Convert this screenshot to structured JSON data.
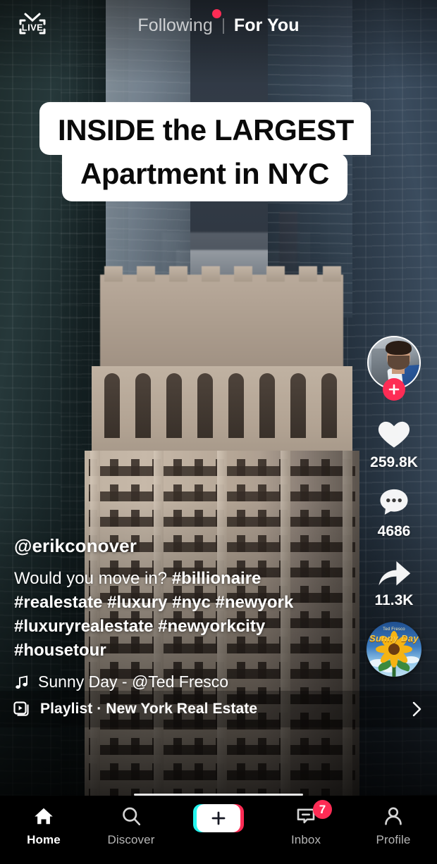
{
  "top_nav": {
    "live_label": "LIVE",
    "live_icon": "live-tv-icon",
    "tabs": [
      {
        "label": "Following",
        "active": false,
        "has_dot_badge": true
      },
      {
        "label": "For You",
        "active": true,
        "has_dot_badge": false
      }
    ]
  },
  "video": {
    "sticker_lines": [
      "INSIDE the LARGEST",
      "Apartment in NYC"
    ],
    "sticker_bg": "#ffffff",
    "sticker_text_color": "#0a0a0a"
  },
  "actions": {
    "avatar_alt": "erikconover-avatar",
    "follow_label": "+",
    "like": {
      "icon": "heart-icon",
      "count": "259.8K"
    },
    "comment": {
      "icon": "comment-icon",
      "count": "4686"
    },
    "share": {
      "icon": "share-arrow-icon",
      "count": "11.3K"
    },
    "disc": {
      "icon": "music-disc-icon",
      "art_title": "Sunny Day",
      "art_subtitle": "Ted Fresco"
    }
  },
  "post": {
    "username": "@erikconover",
    "caption_plain": "Would you move in? ",
    "caption_tags": "#billionaire #realestate #luxury #nyc #newyork #luxuryrealestate #newyorkcity #housetour",
    "music_icon": "music-note-icon",
    "music_text": "Sunny Day - @Ted Fresco"
  },
  "playlist": {
    "icon": "playlist-icon",
    "label": "Playlist · New York Real Estate",
    "chevron": "chevron-right-icon"
  },
  "bottom_nav": {
    "items": [
      {
        "label": "Home",
        "icon": "home-icon",
        "active": true,
        "badge": ""
      },
      {
        "label": "Discover",
        "icon": "search-icon",
        "active": false,
        "badge": ""
      },
      {
        "label": "",
        "icon": "create-plus-icon",
        "active": false,
        "badge": ""
      },
      {
        "label": "Inbox",
        "icon": "inbox-message-icon",
        "active": false,
        "badge": "7"
      },
      {
        "label": "Profile",
        "icon": "person-icon",
        "active": false,
        "badge": ""
      }
    ]
  },
  "colors": {
    "accent_pink": "#fe2c55",
    "accent_cyan": "#25f4ee",
    "nav_bg": "#000000",
    "inactive_text": "#b6b6b6"
  }
}
